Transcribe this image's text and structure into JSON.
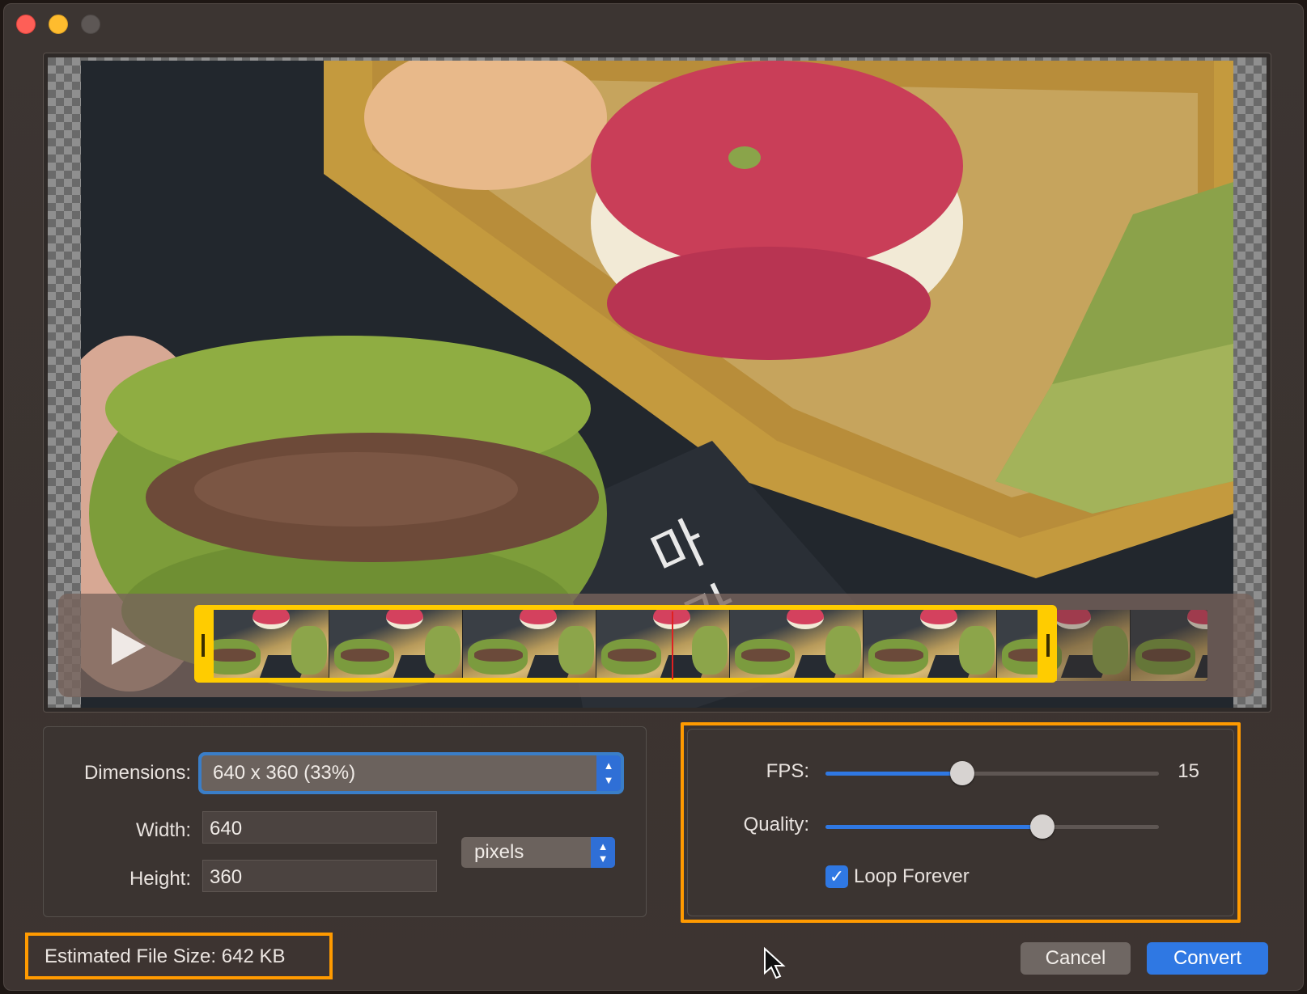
{
  "window": {
    "controls": [
      "close",
      "minimize",
      "zoom"
    ]
  },
  "preview": {
    "play_icon": "play-icon"
  },
  "dimensions": {
    "label": "Dimensions:",
    "selected": "640 x 360 (33%)",
    "width_label": "Width:",
    "width_value": "640",
    "height_label": "Height:",
    "height_value": "360",
    "unit_selected": "pixels"
  },
  "playback": {
    "fps_label": "FPS:",
    "fps_value": "15",
    "fps_fraction": 0.41,
    "quality_label": "Quality:",
    "quality_fraction": 0.65,
    "loop_label": "Loop Forever",
    "loop_checked": true
  },
  "footer": {
    "estimated_size": "Estimated File Size: 642 KB",
    "cancel_label": "Cancel",
    "convert_label": "Convert"
  },
  "colors": {
    "accent": "#2f78e3",
    "trim_handle": "#ffcc00",
    "highlight_box": "#ff9a00"
  }
}
